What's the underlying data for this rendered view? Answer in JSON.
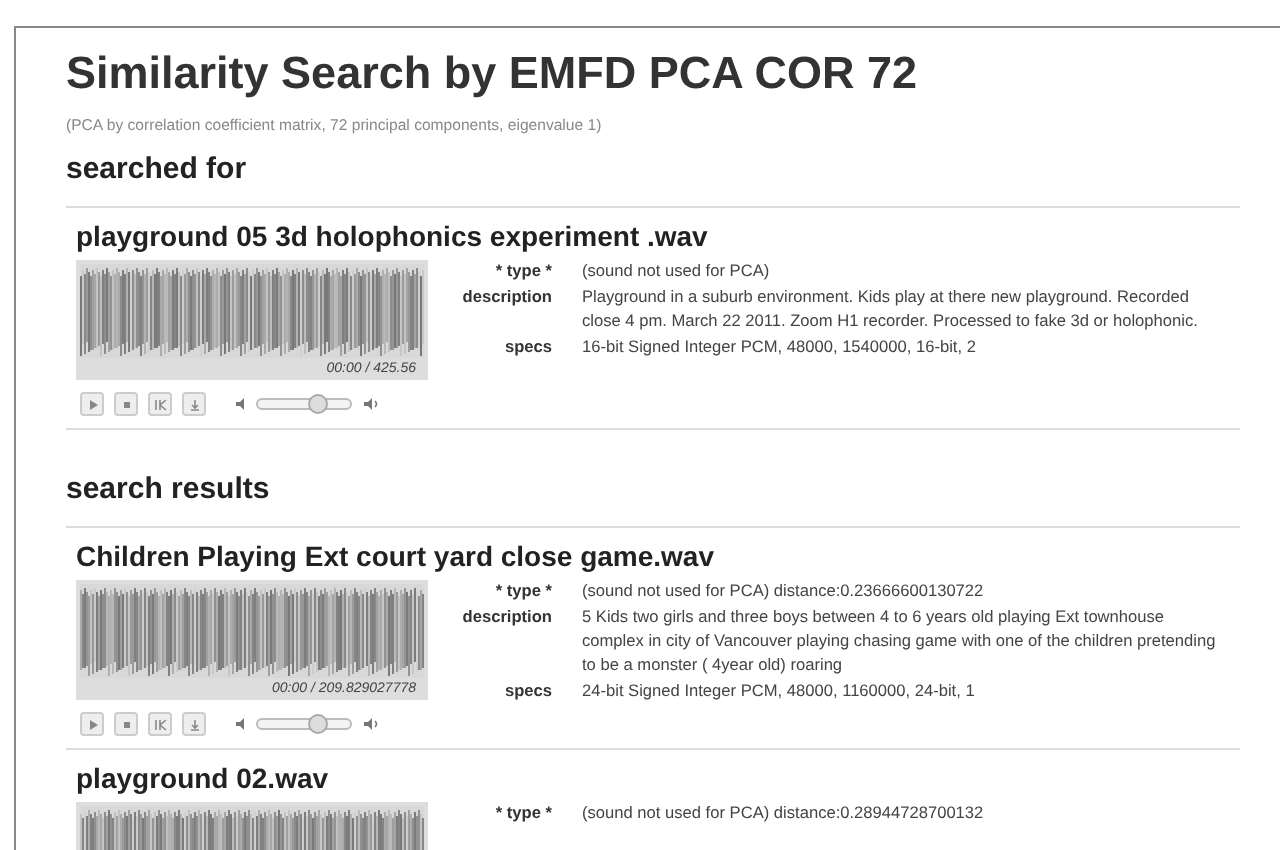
{
  "title": "Similarity Search by EMFD PCA COR 72",
  "subtitle": "(PCA by correlation coefficient matrix, 72 principal components, eigenvalue 1)",
  "sections": [
    {
      "heading": "searched for",
      "sounds": [
        {
          "name": "playground 05 3d holophonics experiment .wav",
          "time": "00:00 / 425.56",
          "volume": {
            "level": 0.65
          },
          "details": [
            {
              "label": "* type *",
              "value": "(sound not used for PCA)"
            },
            {
              "label": "description",
              "value": "Playground in a suburb environment. Kids play at there new playground. Recorded close 4 pm. March 22 2011. Zoom H1 recorder. Processed to fake 3d or holophonic."
            },
            {
              "label": "specs",
              "value": "16-bit Signed Integer PCM, 48000, 1540000, 16-bit, 2"
            }
          ]
        }
      ]
    },
    {
      "heading": "search results",
      "sounds": [
        {
          "name": "Children Playing Ext court yard close game.wav",
          "time": "00:00 / 209.829027778",
          "volume": {
            "level": 0.65
          },
          "details": [
            {
              "label": "* type *",
              "value": "(sound not used for PCA) distance:0.23666600130722"
            },
            {
              "label": "description",
              "value": "5 Kids two girls and three boys between 4 to 6 years old playing Ext townhouse complex in city of Vancouver playing chasing game with one of the children pretending to be a monster ( 4year old) roaring"
            },
            {
              "label": "specs",
              "value": "24-bit Signed Integer PCM, 48000, 1160000, 24-bit, 1"
            }
          ]
        },
        {
          "name": "playground 02.wav",
          "details": [
            {
              "label": "* type *",
              "value": "(sound not used for PCA) distance:0.28944728700132"
            }
          ]
        }
      ]
    }
  ]
}
